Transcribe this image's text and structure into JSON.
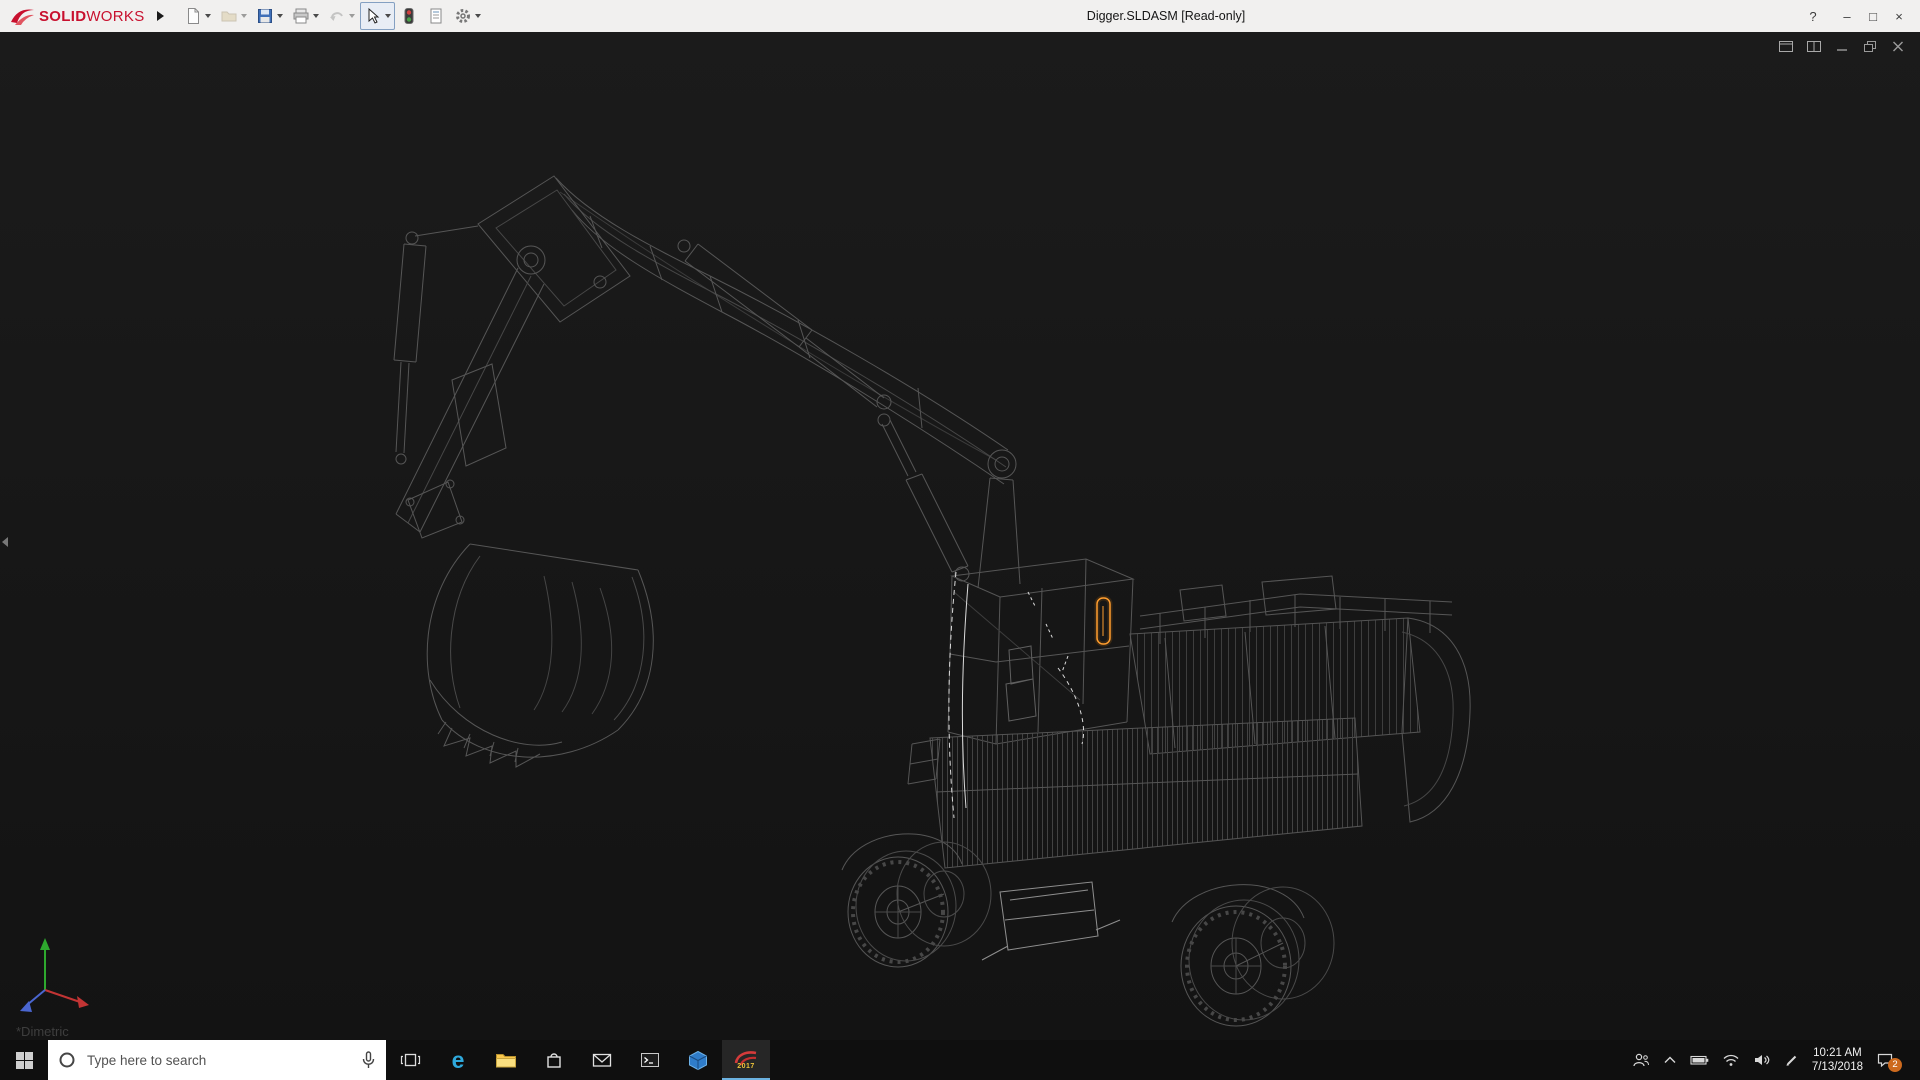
{
  "titlebar": {
    "brand_primary": "SOLID",
    "brand_secondary": "WORKS",
    "brand_color": "#c8102e",
    "title": "Digger.SLDASM [Read-only]",
    "window_controls": {
      "help": "?",
      "minimize": "–",
      "maximize": "□",
      "close": "×"
    },
    "toolbar_icons": [
      "new-document",
      "open",
      "save",
      "print",
      "undo",
      "select",
      "rebuild",
      "file-properties",
      "options"
    ]
  },
  "viewport": {
    "view_orientation": "*Dimetric",
    "model": "Digger (wireframe excavator assembly)",
    "colors": {
      "background": "#161616",
      "wireframe": "#565656",
      "selection_highlight": "#dcdcdc",
      "selected_component": "#ff9d2e",
      "triad_x": "#c23434",
      "triad_y": "#2ea82e",
      "triad_z": "#4a66d0"
    }
  },
  "taskbar": {
    "search_placeholder": "Type here to search",
    "edge_glyph": "e",
    "solidworks_year": "2017",
    "app_icons": [
      "start",
      "task-view",
      "microsoft-edge",
      "file-explorer",
      "store",
      "mail",
      "command-prompt",
      "edrawings",
      "solidworks-2017"
    ],
    "tray_icons": [
      "people",
      "hidden-icons",
      "battery",
      "wifi",
      "volume",
      "pen",
      "action-center"
    ],
    "clock_time": "10:21 AM",
    "clock_date": "7/13/2018",
    "notification_count": "2"
  }
}
